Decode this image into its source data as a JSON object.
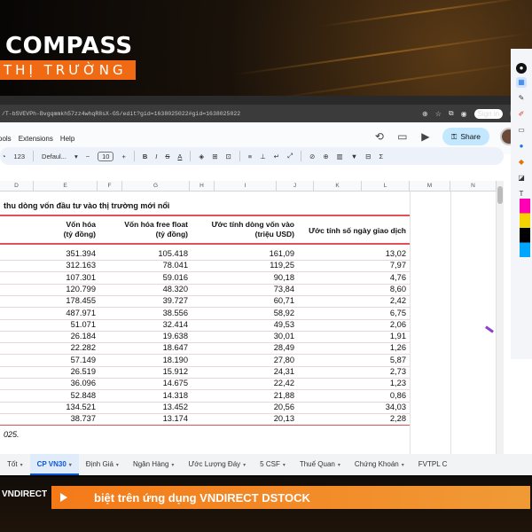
{
  "brand": {
    "title": "COMPASS",
    "subtitle": "THỊ TRƯỜNG"
  },
  "browser": {
    "url": "/T-bSVEVPh-Bvgqmmkh57zz4whqR8sX-GS/edit?gid=1638025022#gid=1638025022",
    "signin": "Sign in"
  },
  "app": {
    "menu": [
      "ools",
      "Extensions",
      "Help"
    ],
    "share_label": "Share",
    "toolbar": {
      "zoom": "123",
      "font": "Defaul...",
      "font_size": "10"
    }
  },
  "sheet": {
    "columns": [
      "D",
      "E",
      "F",
      "G",
      "H",
      "I",
      "J",
      "K",
      "L",
      "M",
      "N"
    ],
    "title": "thu dòng vốn đầu tư vào thị trường mới nổi",
    "headers": {
      "market_cap": [
        "Vốn hóa",
        "(tỷ đồng)"
      ],
      "free_float": [
        "Vốn hóa free float",
        "(tỷ đồng)"
      ],
      "inflow": [
        "Ước tính dòng vốn vào",
        "(triệu USD)"
      ],
      "days": [
        "Ước tính số ngày giao dịch"
      ]
    },
    "rows": [
      {
        "market_cap": "351.394",
        "free_float": "105.418",
        "inflow": "161,09",
        "days": "13,02"
      },
      {
        "market_cap": "312.163",
        "free_float": "78.041",
        "inflow": "119,25",
        "days": "7,97"
      },
      {
        "market_cap": "107.301",
        "free_float": "59.016",
        "inflow": "90,18",
        "days": "4,76"
      },
      {
        "market_cap": "120.799",
        "free_float": "48.320",
        "inflow": "73,84",
        "days": "8,60"
      },
      {
        "market_cap": "178.455",
        "free_float": "39.727",
        "inflow": "60,71",
        "days": "2,42"
      },
      {
        "market_cap": "487.971",
        "free_float": "38.556",
        "inflow": "58,92",
        "days": "6,75"
      },
      {
        "market_cap": "51.071",
        "free_float": "32.414",
        "inflow": "49,53",
        "days": "2,06"
      },
      {
        "market_cap": "26.184",
        "free_float": "19.638",
        "inflow": "30,01",
        "days": "1,91"
      },
      {
        "market_cap": "22.282",
        "free_float": "18.647",
        "inflow": "28,49",
        "days": "1,26"
      },
      {
        "market_cap": "57.149",
        "free_float": "18.190",
        "inflow": "27,80",
        "days": "5,87"
      },
      {
        "market_cap": "26.519",
        "free_float": "15.912",
        "inflow": "24,31",
        "days": "2,73"
      },
      {
        "market_cap": "36.096",
        "free_float": "14.675",
        "inflow": "22,42",
        "days": "1,23"
      },
      {
        "market_cap": "52.848",
        "free_float": "14.318",
        "inflow": "21,88",
        "days": "0,86"
      },
      {
        "market_cap": "134.521",
        "free_float": "13.452",
        "inflow": "20,56",
        "days": "34,03"
      },
      {
        "market_cap": "38.737",
        "free_float": "13.174",
        "inflow": "20,13",
        "days": "2,28"
      }
    ],
    "note": "025."
  },
  "tabs": [
    {
      "label": "Tốt",
      "active": false
    },
    {
      "label": "CP VN30",
      "active": true
    },
    {
      "label": "Định Giá",
      "active": false
    },
    {
      "label": "Ngân Hàng",
      "active": false
    },
    {
      "label": "Ước Lượng Đáy",
      "active": false
    },
    {
      "label": "5 CSF",
      "active": false
    },
    {
      "label": "Thuế Quan",
      "active": false
    },
    {
      "label": "Chứng Khoán",
      "active": false
    },
    {
      "label": "FVTPL C",
      "active": false
    }
  ],
  "ticker": {
    "brand": "VNDIRECT",
    "text": "biệt trên ứng dụng VNDIRECT DSTOCK"
  },
  "colors": {
    "accent": "#ef6a12",
    "share_bg": "#c2e7ff",
    "red_rule": "#e0515a",
    "active_tab": "#0b57d0"
  }
}
